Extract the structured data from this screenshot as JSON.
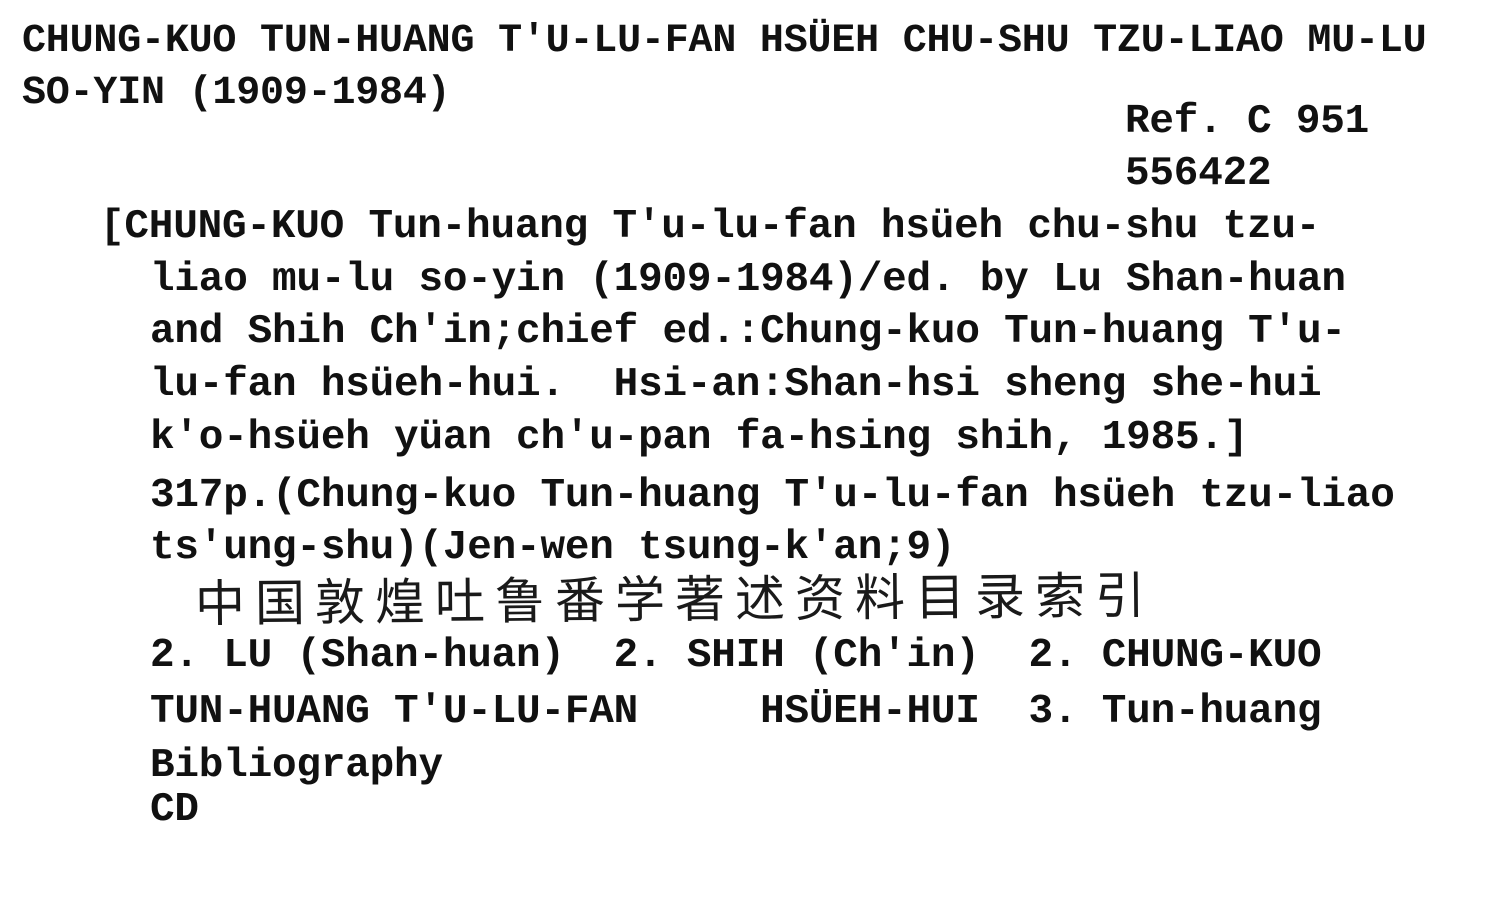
{
  "heading": {
    "line1": "CHUNG-KUO TUN-HUANG T'U-LU-FAN HSÜEH CHU-SHU TZU-LIAO MU-LU",
    "line2": "SO-YIN (1909-1984)"
  },
  "call_number": {
    "line1": "Ref. C 951",
    "line2": "556422"
  },
  "body_lines": [
    "[CHUNG-KUO Tun-huang T'u-lu-fan hsüeh chu-shu tzu-",
    "liao mu-lu so-yin (1909-1984)/ed. by Lu Shan-huan",
    "and Shih Ch'in;chief ed.:Chung-kuo Tun-huang T'u-",
    "lu-fan hsüeh-hui.  Hsi-an:Shan-hsi sheng she-hui",
    "k'o-hsüeh yüan ch'u-pan fa-hsing shih, 1985.]",
    "317p.(Chung-kuo Tun-huang T'u-lu-fan hsüeh tzu-liao",
    "ts'ung-shu)(Jen-wen tsung-k'an;9)"
  ],
  "handwritten_chinese": "中国敦煌吐鲁番学著述资料目录索引",
  "tracings": [
    "2. LU (Shan-huan)  2. SHIH (Ch'in)  2. CHUNG-KUO",
    "TUN-HUANG T'U-LU-FAN     HSÜEH-HUI  3. Tun-huang",
    "Bibliography",
    "CD"
  ]
}
